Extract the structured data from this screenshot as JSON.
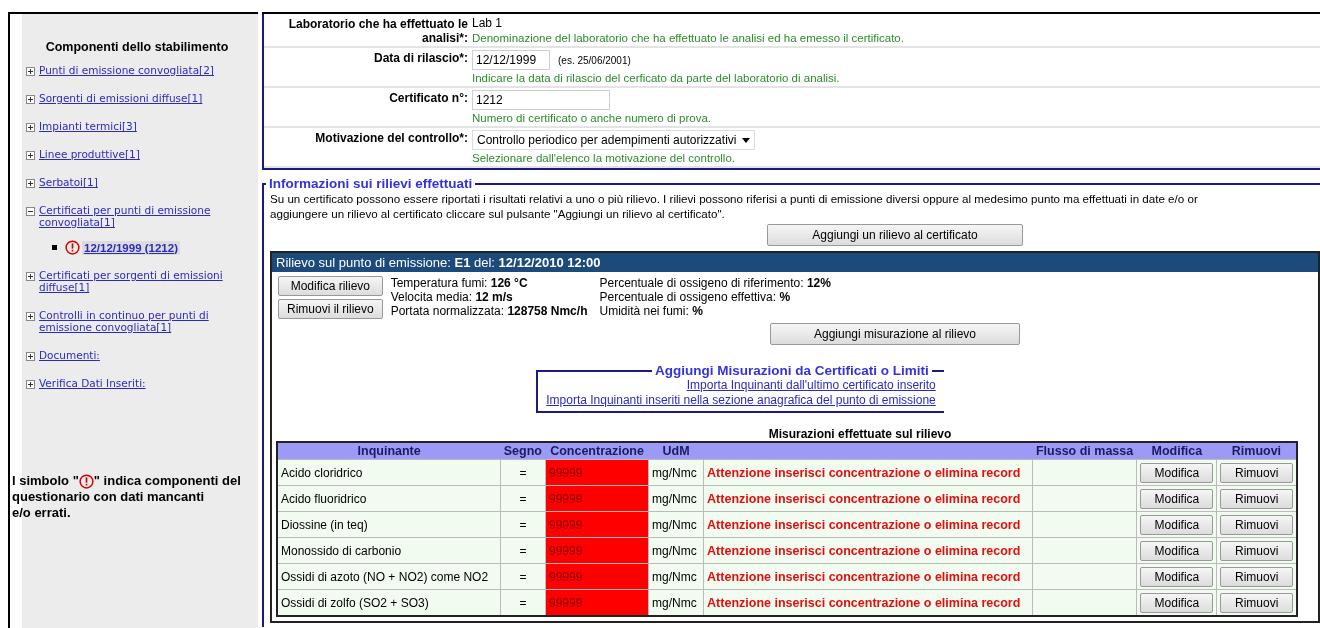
{
  "sidebar": {
    "title": "Componenti dello stabilimento",
    "items": [
      {
        "label": "Punti di emissione convogliata[2]",
        "expanded": false
      },
      {
        "label": "Sorgenti di emissioni diffuse[1]",
        "expanded": false
      },
      {
        "label": "Impianti termici[3]",
        "expanded": false
      },
      {
        "label": "Linee produttive[1]",
        "expanded": false
      },
      {
        "label": "Serbatoi[1]",
        "expanded": false
      },
      {
        "label": "Certificati per punti di emissione convogliata[1]",
        "expanded": true,
        "children": [
          {
            "label": "12/12/1999 (1212)",
            "warning": true,
            "selected": true
          }
        ]
      },
      {
        "label": "Certificati per sorgenti di emissioni diffuse[1]",
        "expanded": false
      },
      {
        "label": "Controlli in continuo per punti di emissione convogliata[1]",
        "expanded": false
      },
      {
        "label": "Documenti:",
        "expanded": false
      },
      {
        "label": "Verifica Dati Inseriti:",
        "expanded": false
      }
    ],
    "note_before": "l simbolo \"",
    "note_after": "\" indica componenti del",
    "note_rest": "questionario con dati mancanti e/o errati."
  },
  "form": {
    "rows": [
      {
        "kind": "text",
        "label": "Laboratorio che ha effettuato le analisi*:",
        "value": "Lab 1",
        "help": "Denominazione del laboratorio che ha effettuato le analisi ed ha emesso il certificato."
      },
      {
        "kind": "date",
        "label": "Data di rilascio*:",
        "value": "12/12/1999",
        "example": "(es.  25/06/2001)",
        "help": "Indicare la data di rilascio del cerficato da parte del laboratorio di analisi."
      },
      {
        "kind": "text",
        "label": "Certificato n°:",
        "value": "1212",
        "help": "Numero di certificato o anche numero di prova."
      },
      {
        "kind": "select",
        "label": "Motivazione del controllo*:",
        "value": "Controllo periodico per adempimenti autorizzativi",
        "help": "Selezionare dall'elenco la motivazione del controllo."
      }
    ]
  },
  "rilievi": {
    "legend": "Informazioni sui rilievi effettuati",
    "description": [
      "Su un certificato possono essere riportati i  risultati relativi a uno o più rilievo. I rilievi possono riferisi a punti di emissione diversi oppure al medesimo punto ma effettuati in date e/o or",
      "aggiungere un rilievo al certificato cliccare sul pulsante \"Aggiungi un rilievo al certificato\"."
    ],
    "add_button": "Aggiungi un rilievo al certificato",
    "rilievo": {
      "header": "Rilievo sul punto di emissione: **E1** del: **12/12/2010 12:00**",
      "buttons": [
        "Modifica rilievo",
        "Rimuovi il rilievo"
      ],
      "params_columns": [
        [
          "Temperatura fumi: **126 °C**",
          "Velocita media: **12 m/s**",
          "Portata normalizzata: **128758 Nmc/h**"
        ],
        [
          "Percentuale di ossigeno di riferimento: **12%**",
          "Percentuale di ossigeno effettiva: **%**",
          "Umidità nei fumi: **%**"
        ]
      ],
      "add_measure_button": "Aggiungi misurazione al rilievo",
      "import_box": {
        "legend": "Aggiungi Misurazioni da Certificati o Limiti",
        "links": [
          "Importa Inquinanti dall'ultimo certificato inserito",
          "Importa Inquinanti inseriti nella sezione anagrafica del punto di emissione"
        ]
      },
      "table": {
        "caption": "Misurazioni effettuate sul rilievo",
        "columns": [
          "Inquinante",
          "Segno",
          "Concentrazione",
          "UdM",
          "",
          "Flusso di massa",
          "Modifica",
          "Rimuovi"
        ],
        "rows": [
          {
            "inquinante": "Acido cloridrico",
            "segno": "=",
            "concentrazione": "99999",
            "invalid": true,
            "udm": "mg/Nmc",
            "message": "Attenzione inserisci concentrazione o elimina record",
            "modify_button": "Modifica",
            "remove_button": "Rimuovi"
          },
          {
            "inquinante": "Acido fluoridrico",
            "segno": "=",
            "concentrazione": "99999",
            "invalid": true,
            "udm": "mg/Nmc",
            "message": "Attenzione inserisci concentrazione o elimina record",
            "modify_button": "Modifica",
            "remove_button": "Rimuovi"
          },
          {
            "inquinante": "Diossine (in teq)",
            "segno": "=",
            "concentrazione": "99999",
            "invalid": true,
            "udm": "mg/Nmc",
            "message": "Attenzione inserisci concentrazione o elimina record",
            "modify_button": "Modifica",
            "remove_button": "Rimuovi"
          },
          {
            "inquinante": "Monossido di carbonio",
            "segno": "=",
            "concentrazione": "99999",
            "invalid": true,
            "udm": "mg/Nmc",
            "message": "Attenzione inserisci concentrazione o elimina record",
            "modify_button": "Modifica",
            "remove_button": "Rimuovi"
          },
          {
            "inquinante": "Ossidi di azoto (NO + NO2) come NO2",
            "segno": "=",
            "concentrazione": "99999",
            "invalid": true,
            "udm": "mg/Nmc",
            "message": "Attenzione inserisci concentrazione o elimina record",
            "modify_button": "Modifica",
            "remove_button": "Rimuovi"
          },
          {
            "inquinante": "Ossidi di zolfo (SO2 + SO3)",
            "segno": "=",
            "concentrazione": "99999",
            "invalid": true,
            "udm": "mg/Nmc",
            "message": "Attenzione inserisci concentrazione o elimina record",
            "modify_button": "Modifica",
            "remove_button": "Rimuovi"
          }
        ]
      }
    }
  }
}
